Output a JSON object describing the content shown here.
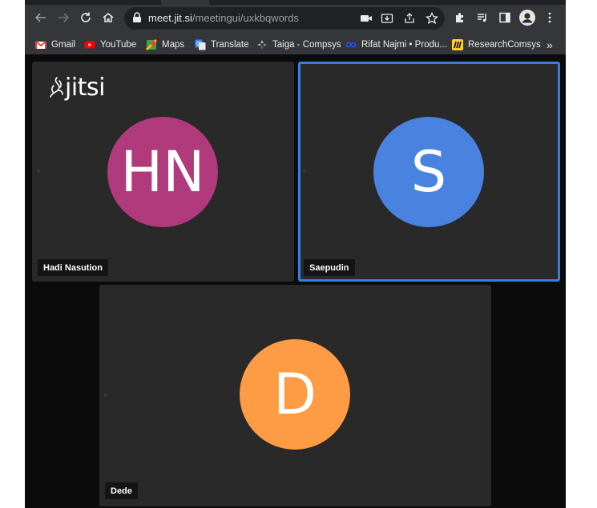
{
  "browser": {
    "url_host": "meet.jit.si",
    "url_path": "/meetingui/uxkbqwords"
  },
  "bookmarks": [
    {
      "label": "Gmail",
      "icon": "gmail-icon"
    },
    {
      "label": "YouTube",
      "icon": "youtube-icon"
    },
    {
      "label": "Maps",
      "icon": "maps-icon"
    },
    {
      "label": "Translate",
      "icon": "translate-icon"
    },
    {
      "label": "Taiga - Compsys",
      "icon": "taiga-icon"
    },
    {
      "label": "Rifat Najmi • Produ...",
      "icon": "bookmark-site-icon"
    },
    {
      "label": "ResearchComsys",
      "icon": "miro-icon"
    }
  ],
  "bookmarks_overflow": "»",
  "logo": {
    "text": "jitsi"
  },
  "participants": [
    {
      "initials": "HN",
      "name": "Hadi Nasution",
      "color": "#b03a7c",
      "active": false
    },
    {
      "initials": "S",
      "name": "Saepudin",
      "color": "#4a82e0",
      "active": true
    },
    {
      "initials": "D",
      "name": "Dede",
      "color": "#fd9c44",
      "active": false
    }
  ],
  "colors": {
    "active_border": "#3d7cde",
    "tile_bg": "#292929",
    "stage_bg": "#0b0b0b"
  }
}
